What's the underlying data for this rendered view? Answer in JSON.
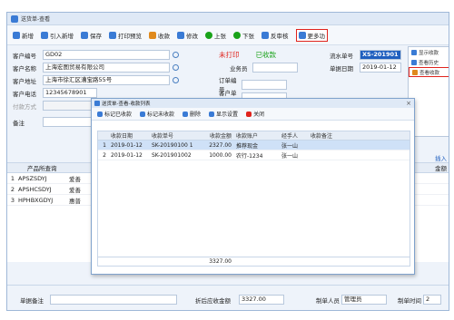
{
  "window": {
    "title": "送货单-查看"
  },
  "toolbar": {
    "items": [
      {
        "label": "新增",
        "icon": "add-icon",
        "color": "#3a7bd5"
      },
      {
        "label": "引入新增",
        "icon": "import-icon",
        "color": "#3a7bd5"
      },
      {
        "label": "保存",
        "icon": "save-icon",
        "color": "#3a7bd5"
      },
      {
        "label": "打印预览",
        "icon": "print-icon",
        "color": "#3a7bd5"
      },
      {
        "label": "收款",
        "icon": "cash-icon",
        "color": "#e08a1d"
      },
      {
        "label": "修改",
        "icon": "edit-icon",
        "color": "#3a7bd5"
      },
      {
        "label": "上张",
        "icon": "prev-icon",
        "color": "#1aa31a"
      },
      {
        "label": "下张",
        "icon": "next-icon",
        "color": "#1aa31a"
      },
      {
        "label": "反审核",
        "icon": "unaudit-icon",
        "color": "#3a7bd5"
      },
      {
        "label": "更多功",
        "icon": "more-icon",
        "color": "#3a7bd5"
      }
    ]
  },
  "form": {
    "customer_code_label": "客户编号",
    "customer_code": "GD02",
    "customer_name_label": "客户名称",
    "customer_name": "上海宏图贸易有限公司",
    "customer_addr_label": "客户地址",
    "customer_addr": "上海市徐汇区漕宝路55号",
    "customer_phone_label": "客户电话",
    "customer_phone": "12345678901",
    "payment_label": "付款方式",
    "business_label": "业务员",
    "doc_date_label": "单据日期",
    "doc_date": "2019-01-12",
    "order_no_label": "订单编号",
    "customer_po_label": "客户单号",
    "flow_no_label": "流水单号",
    "flow_no": "XS-201901",
    "status_print": "未打印",
    "status_paid": "已收款",
    "remark_label": "备注"
  },
  "dropdown": {
    "items": [
      {
        "label": "显示收款",
        "color": "#3a7bd5"
      },
      {
        "label": "查看历史",
        "color": "#3a7bd5"
      },
      {
        "label": "查看收款",
        "color": "#e08a1d"
      }
    ]
  },
  "main_grid": {
    "header": "产品所查询",
    "rows": [
      {
        "n": "1",
        "code": "APSZSDYJ",
        "name": "爱善"
      },
      {
        "n": "2",
        "code": "APSHCSDYJ",
        "name": "爱善"
      },
      {
        "n": "3",
        "code": "HPHBXGDYJ",
        "name": "惠普"
      }
    ],
    "right_header": "金额",
    "right_link": "插入",
    "total": "3"
  },
  "footer": {
    "remark_label": "单据备注",
    "discount_label": "折后应收金额",
    "discount_value": "3327.00",
    "maker_label": "制单人员",
    "maker_value": "管理员",
    "make_time_label": "制单时间",
    "make_time_value": "2"
  },
  "dialog": {
    "title": "送货单-查看-收款列表",
    "close": "×",
    "toolbar": [
      {
        "label": "标记已收款",
        "color": "#3a7bd5"
      },
      {
        "label": "标记未收款",
        "color": "#3a7bd5"
      },
      {
        "label": "删除",
        "color": "#3a7bd5"
      },
      {
        "label": "显示设置",
        "color": "#3a7bd5"
      },
      {
        "label": "关闭",
        "color": "#e0241d"
      }
    ],
    "columns": [
      "",
      "收款日期",
      "收款单号",
      "收款金额",
      "收款账户",
      "经手人",
      "收款备注"
    ],
    "rows": [
      [
        "1",
        "2019-01-12",
        "SK-20190100 1",
        "2327.00",
        "推荐现金",
        "张一山",
        ""
      ],
      [
        "2",
        "2019-01-12",
        "SK-201901002",
        "1000.00",
        "农行-1234",
        "张一山",
        ""
      ]
    ],
    "total": "3327.00"
  }
}
